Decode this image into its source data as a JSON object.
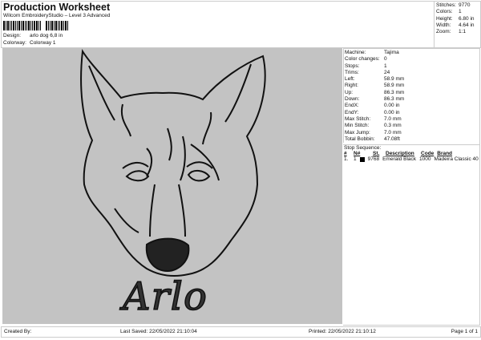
{
  "header": {
    "title": "Production Worksheet",
    "software": "Wilcom EmbroideryStudio – Level 3 Advanced",
    "design_label": "Design:",
    "design_value": "arlo dog 6,8 in",
    "colorway_label": "Colorway:",
    "colorway_value": "Colorway 1"
  },
  "stats": [
    {
      "k": "Stitches:",
      "v": "9770"
    },
    {
      "k": "Colors:",
      "v": "1"
    },
    {
      "k": "Height:",
      "v": "6.80 in"
    },
    {
      "k": "Width:",
      "v": "4.64 in"
    },
    {
      "k": "Zoom:",
      "v": "1:1"
    }
  ],
  "info": [
    {
      "k": "Machine:",
      "v": "Tajima"
    },
    {
      "k": "Color changes:",
      "v": "0"
    },
    {
      "k": "Stops:",
      "v": "1"
    },
    {
      "k": "Trims:",
      "v": "24"
    },
    {
      "k": "Left:",
      "v": "58.9 mm"
    },
    {
      "k": "Right:",
      "v": "58.9 mm"
    },
    {
      "k": "Up:",
      "v": "86.3 mm"
    },
    {
      "k": "Down:",
      "v": "86.3 mm"
    },
    {
      "k": "EndX:",
      "v": "0.00 in"
    },
    {
      "k": "EndY:",
      "v": "0.00 in"
    },
    {
      "k": "Max Stitch:",
      "v": "7.0 mm"
    },
    {
      "k": "Min Stitch:",
      "v": "0.3 mm"
    },
    {
      "k": "Max Jump:",
      "v": "7.0 mm"
    },
    {
      "k": "Total Bobbin:",
      "v": "47.08ft"
    }
  ],
  "stop_sequence": {
    "label": "Stop Sequence:",
    "headers": [
      "#",
      "N#",
      "St.",
      "Description",
      "Code",
      "Brand"
    ],
    "rows": [
      {
        "num": "1.",
        "n": "1",
        "color": "#000000",
        "st": "9768",
        "desc": "Emerald Black",
        "code": "1000",
        "brand": "Madeira Classic 40"
      }
    ]
  },
  "design": {
    "text": "Arlo",
    "background": "#c3c3c3"
  },
  "footer": {
    "created": "Created By:",
    "saved": "Last Saved: 22/05/2022 21:10:04",
    "printed": "Printed: 22/05/2022 21:10:12",
    "page": "Page 1 of 1"
  }
}
